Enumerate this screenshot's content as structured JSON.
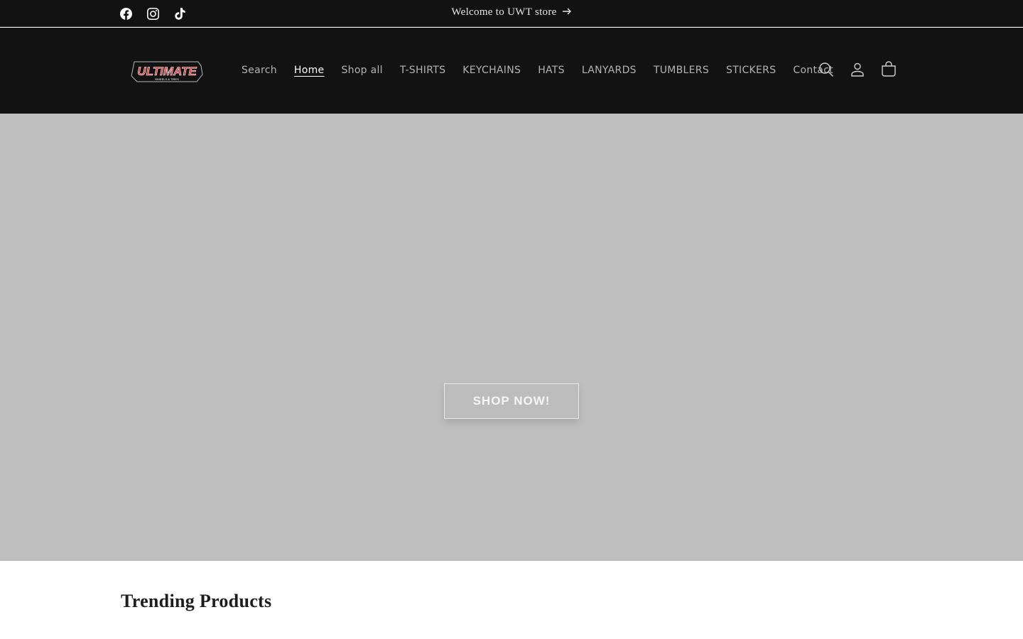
{
  "announcement": {
    "social_icons": [
      "facebook-icon",
      "instagram-icon",
      "tiktok-icon"
    ],
    "text": "Welcome to UWT store",
    "arrow_icon": "arrow-right-icon"
  },
  "header": {
    "logo_text": "ULTIMATE",
    "logo_subtext": "WHEELS & TIRES",
    "nav": [
      "Search",
      "Home",
      "Shop all",
      "T-SHIRTS",
      "KEYCHAINS",
      "HATS",
      "LANYARDS",
      "TUMBLERS",
      "STICKERS",
      "Contact"
    ],
    "active_nav": "Home",
    "icons": [
      "search-icon",
      "account-icon",
      "cart-icon"
    ]
  },
  "hero": {
    "button_label": "SHOP NOW!",
    "background_color": "#bfbfbf"
  },
  "sections": {
    "trending_title": "Trending Products"
  },
  "colors": {
    "header_bg": "#121212",
    "logo_red": "#d43a3a"
  }
}
